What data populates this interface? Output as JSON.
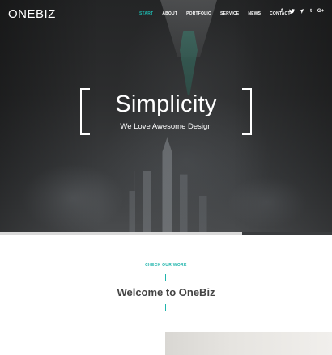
{
  "brand": {
    "logo": "ONEBIZ"
  },
  "nav": {
    "items": [
      {
        "label": "START",
        "active": true
      },
      {
        "label": "ABOUT",
        "active": false
      },
      {
        "label": "PORTFOLIO",
        "active": false
      },
      {
        "label": "SERVICE",
        "active": false
      },
      {
        "label": "NEWS",
        "active": false
      },
      {
        "label": "CONTACT",
        "active": false
      }
    ]
  },
  "social": {
    "items": [
      {
        "icon": "facebook-icon",
        "glyph": "f"
      },
      {
        "icon": "twitter-icon",
        "glyph": "🐦"
      },
      {
        "icon": "foursquare-icon",
        "glyph": "✦"
      },
      {
        "icon": "tumblr-icon",
        "glyph": "t"
      },
      {
        "icon": "google-plus-icon",
        "glyph": "G+"
      }
    ]
  },
  "hero": {
    "title": "Simplicity",
    "subtitle": "We Love Awesome Design",
    "slide_progress": 0.73
  },
  "work": {
    "eyebrow": "CHECK OUR WORK",
    "title": "Welcome to OneBiz"
  },
  "colors": {
    "accent": "#1fb5ac",
    "text_dark": "#444444",
    "hero_bg": "#2c2d2e"
  }
}
